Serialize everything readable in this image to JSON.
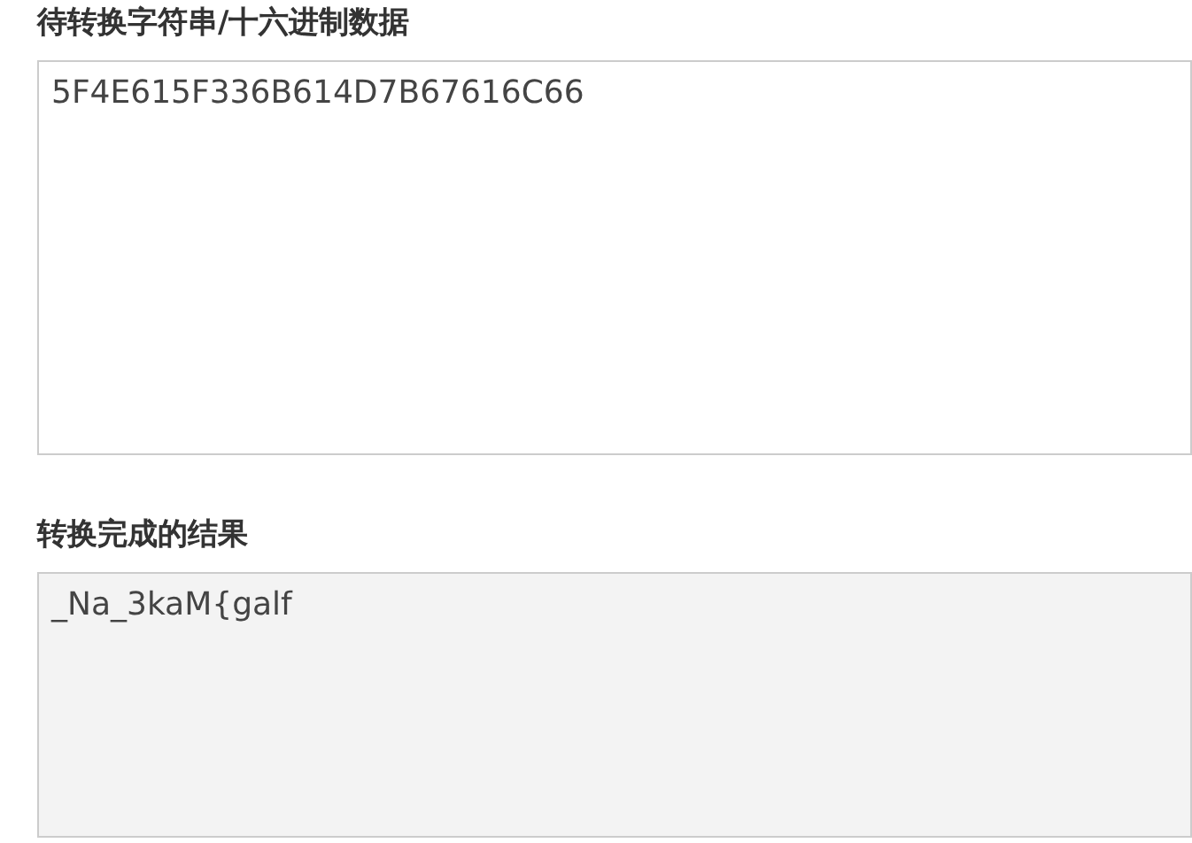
{
  "input_section": {
    "label": "待转换字符串/十六进制数据",
    "value": "5F4E615F336B614D7B67616C66"
  },
  "result_section": {
    "label": "转换完成的结果",
    "value": "_Na_3kaM{galf",
    "readonly": true
  }
}
